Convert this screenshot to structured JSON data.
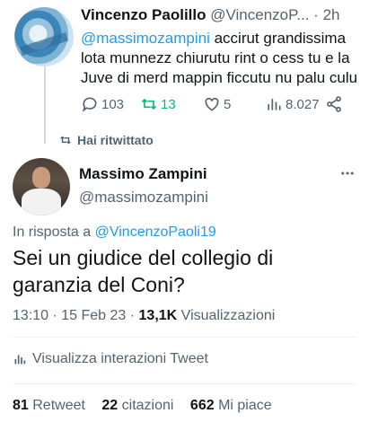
{
  "tweet1": {
    "name": "Vincenzo Paolillo",
    "handle": "@VincenzoP...",
    "dot": "·",
    "time": "2h",
    "mention": "@massimozampini",
    "text": " accirut grandissima lota munnezz chiurutu rint o cess tu e la Juve di merd mappin ficcutu nu palu culu",
    "replies": "103",
    "retweets": "13",
    "likes": "5",
    "views": "8.027"
  },
  "retweet_notice": "Hai ritwittato",
  "tweet2": {
    "name": "Massimo Zampini",
    "handle": "@massimozampini",
    "reply_prefix": "In risposta a ",
    "reply_handle": "@VincenzoPaoli19",
    "text": "Sei un giudice del collegio di garanzia del Coni?",
    "timestamp": "13:10 · 15 Feb 23 · ",
    "views_count": "13,1K",
    "views_label": " Visualizzazioni",
    "insights_label": "Visualizza interazioni Tweet",
    "retweet_count": "81",
    "retweet_label": "Retweet",
    "quote_count": "22",
    "quote_label": "citazioni",
    "like_count": "662",
    "like_label": "Mi piace"
  },
  "colors": {
    "accent": "#1d9bf0",
    "retweet_green": "#00ba7c",
    "secondary_text": "#536471"
  }
}
